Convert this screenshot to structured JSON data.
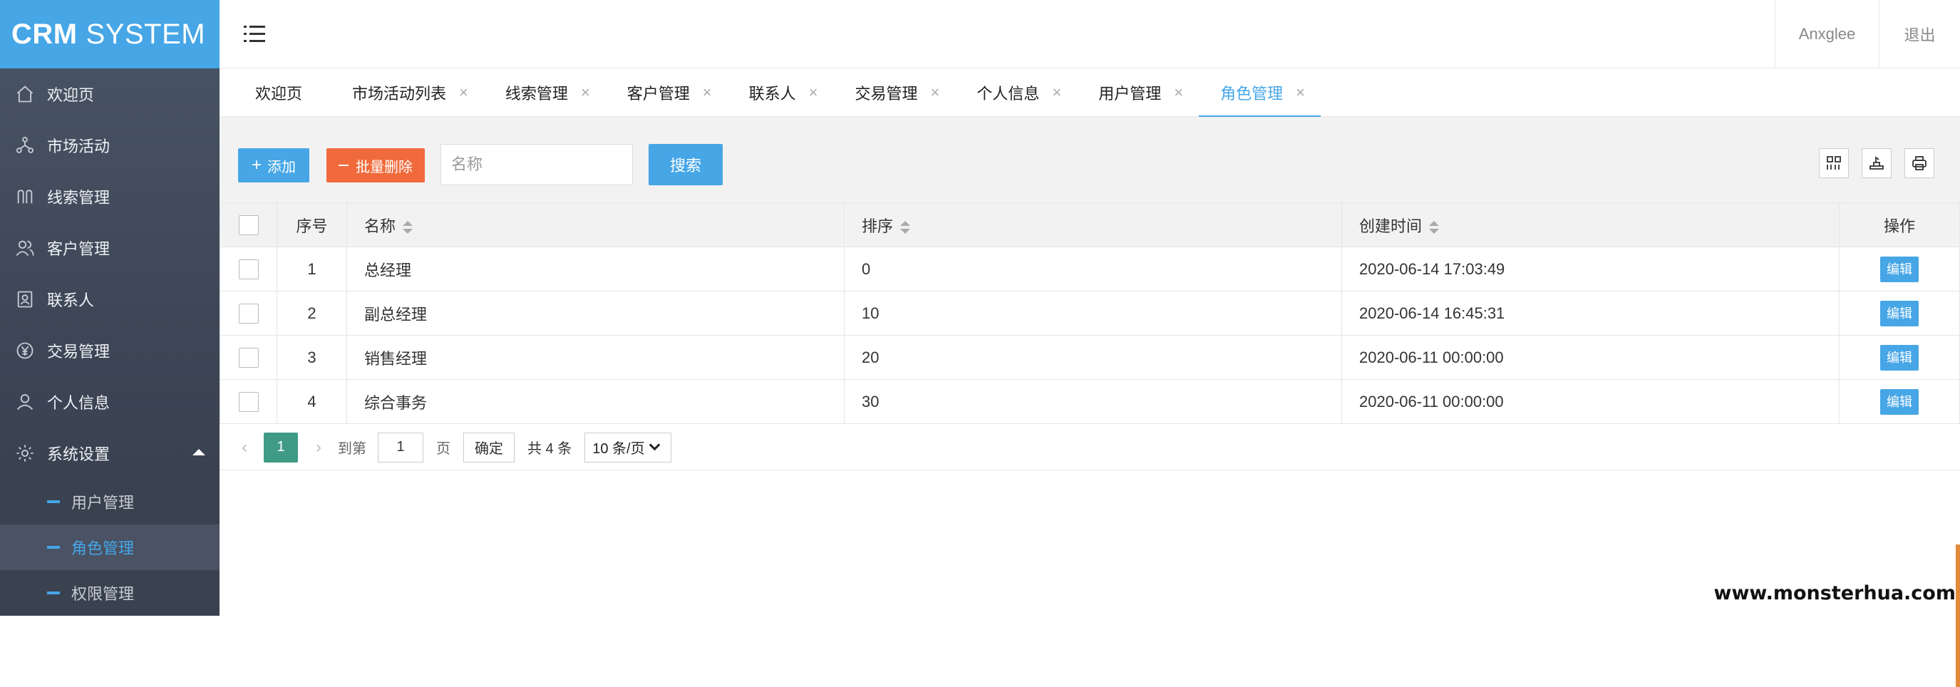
{
  "brand": {
    "bold": "CRM",
    "rest": "SYSTEM"
  },
  "sidebar": {
    "items": [
      {
        "label": "欢迎页",
        "icon": "home-icon"
      },
      {
        "label": "市场活动",
        "icon": "network-icon"
      },
      {
        "label": "线索管理",
        "icon": "clue-icon"
      },
      {
        "label": "客户管理",
        "icon": "customers-icon"
      },
      {
        "label": "联系人",
        "icon": "contact-card-icon"
      },
      {
        "label": "交易管理",
        "icon": "yen-coin-icon"
      },
      {
        "label": "个人信息",
        "icon": "user-icon"
      },
      {
        "label": "系统设置",
        "icon": "gear-icon",
        "expanded": true
      }
    ],
    "sub_items": [
      {
        "label": "用户管理"
      },
      {
        "label": "角色管理",
        "active": true
      },
      {
        "label": "权限管理"
      }
    ]
  },
  "header": {
    "user": "Anxglee",
    "logout": "退出"
  },
  "tabs": [
    {
      "label": "欢迎页"
    },
    {
      "label": "市场活动列表"
    },
    {
      "label": "线索管理"
    },
    {
      "label": "客户管理"
    },
    {
      "label": "联系人"
    },
    {
      "label": "交易管理"
    },
    {
      "label": "个人信息"
    },
    {
      "label": "用户管理"
    },
    {
      "label": "角色管理",
      "active": true
    }
  ],
  "toolbar": {
    "add_label": "添加",
    "batch_delete_label": "批量删除",
    "search_placeholder": "名称",
    "search_label": "搜索"
  },
  "table": {
    "headers": {
      "index": "序号",
      "name": "名称",
      "sort": "排序",
      "created": "创建时间",
      "ops": "操作"
    },
    "rows": [
      {
        "index": "1",
        "name": "总经理",
        "sort": "0",
        "created": "2020-06-14 17:03:49",
        "edit": "编辑"
      },
      {
        "index": "2",
        "name": "副总经理",
        "sort": "10",
        "created": "2020-06-14 16:45:31",
        "edit": "编辑"
      },
      {
        "index": "3",
        "name": "销售经理",
        "sort": "20",
        "created": "2020-06-11 00:00:00",
        "edit": "编辑"
      },
      {
        "index": "4",
        "name": "综合事务",
        "sort": "30",
        "created": "2020-06-11 00:00:00",
        "edit": "编辑"
      }
    ]
  },
  "pagination": {
    "current": "1",
    "goto_label": "到第",
    "goto_value": "1",
    "page_unit": "页",
    "confirm": "确定",
    "total": "共 4 条",
    "page_size": "10 条/页"
  },
  "watermark": "www.monsterhua.com",
  "colors": {
    "accent": "#46a6e6",
    "danger": "#f06a3b",
    "pager_active": "#3f9a86",
    "sidebar": "#3d4656"
  }
}
